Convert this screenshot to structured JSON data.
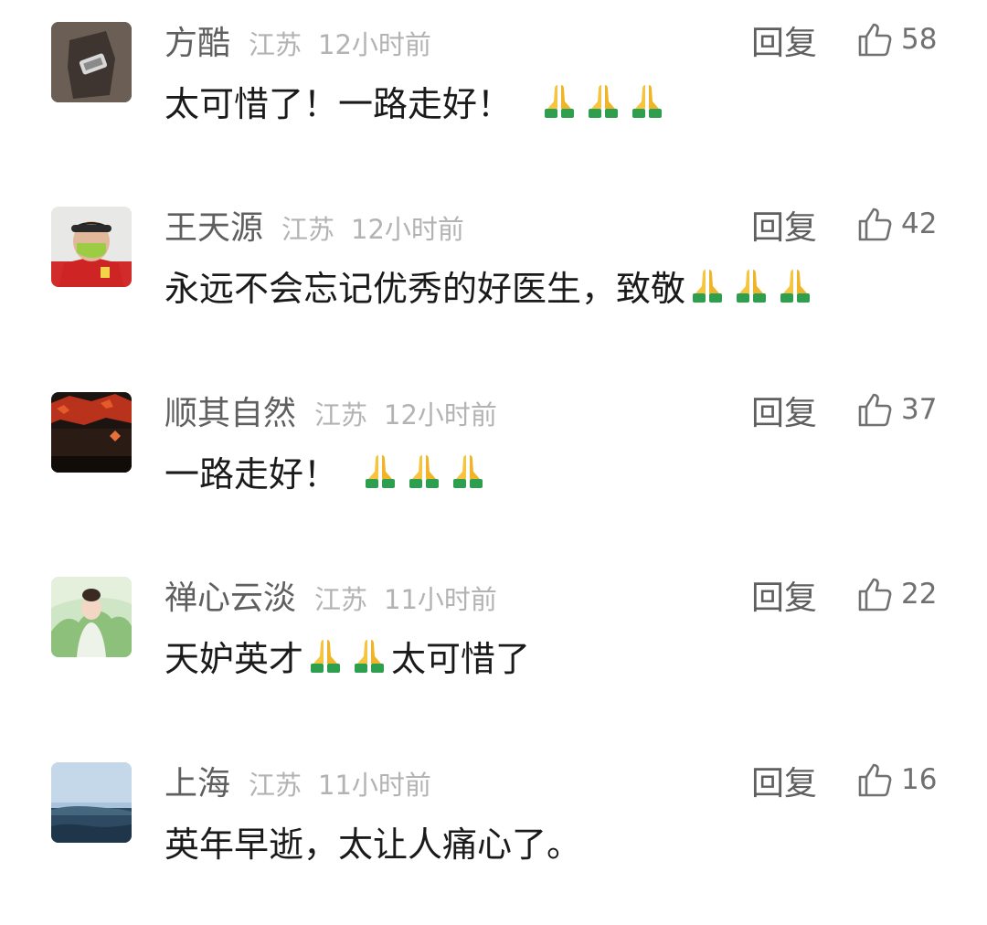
{
  "comments": [
    {
      "username": "方酷",
      "location": "江苏",
      "time": "12小时前",
      "reply_label": "回复",
      "likes": "58",
      "text_before": "太可惜了！一路走好！",
      "emoji_count_before": 3,
      "text_after": ""
    },
    {
      "username": "王天源",
      "location": "江苏",
      "time": "12小时前",
      "reply_label": "回复",
      "likes": "42",
      "text_before": "永远不会忘记优秀的好医生，致敬",
      "emoji_count_before": 3,
      "text_after": ""
    },
    {
      "username": "顺其自然",
      "location": "江苏",
      "time": "12小时前",
      "reply_label": "回复",
      "likes": "37",
      "text_before": "一路走好！",
      "emoji_count_before": 3,
      "text_after": ""
    },
    {
      "username": "禅心云淡",
      "location": "江苏",
      "time": "11小时前",
      "reply_label": "回复",
      "likes": "22",
      "text_before": "天妒英才",
      "emoji_count_before": 2,
      "text_after": "太可惜了"
    },
    {
      "username": "上海",
      "location": "江苏",
      "time": "11小时前",
      "reply_label": "回复",
      "likes": "16",
      "text_before": "英年早逝，太让人痛心了。",
      "emoji_count_before": 0,
      "text_after": ""
    }
  ],
  "icons": {
    "like": "thumbs-up-outline-icon",
    "emoji": "folded-hands-emoji"
  },
  "colors": {
    "username": "#5f5f5f",
    "meta": "#b3b3b3",
    "text": "#1a1a1a"
  }
}
